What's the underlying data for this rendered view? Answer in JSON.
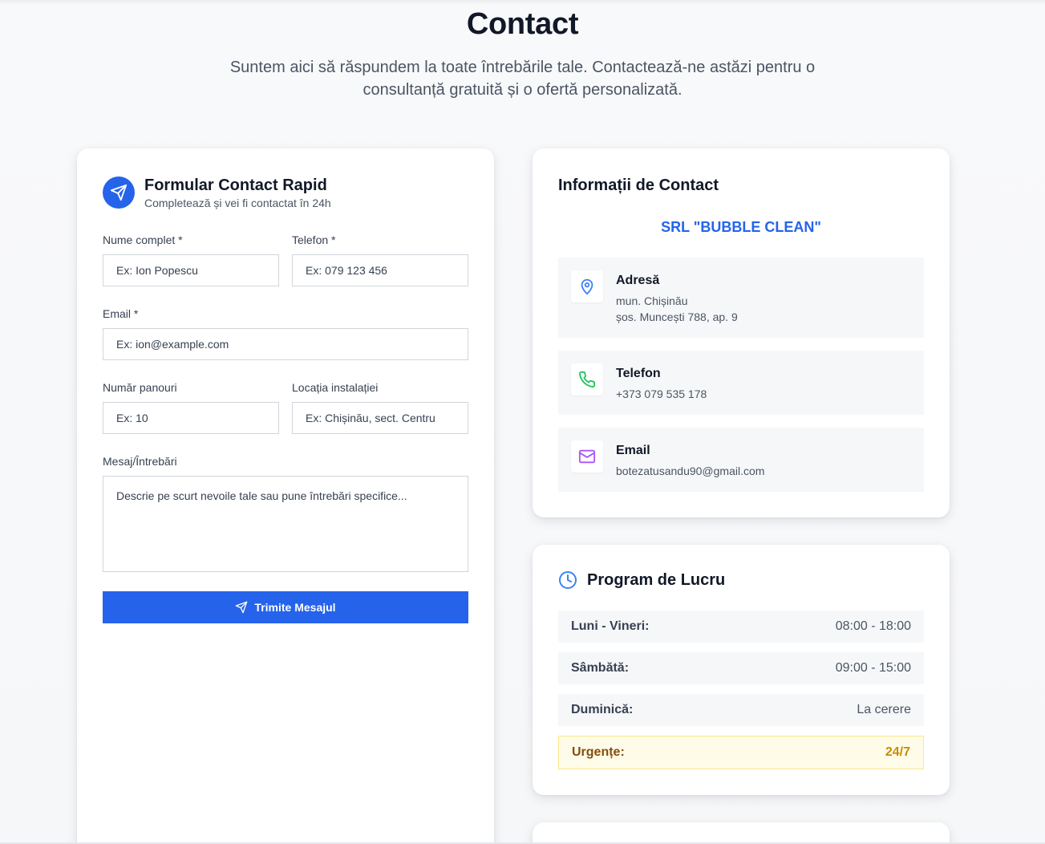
{
  "hero": {
    "title": "Contact",
    "subtitle": "Suntem aici să răspundem la toate întrebările tale. Contactează-ne astăzi pentru o consultanță gratuită și o ofertă personalizată."
  },
  "form": {
    "title": "Formular Contact Rapid",
    "subtitle": "Completează și vei fi contactat în 24h",
    "name_label": "Nume complet *",
    "name_placeholder": "Ex: Ion Popescu",
    "phone_label": "Telefon *",
    "phone_placeholder": "Ex: 079 123 456",
    "email_label": "Email *",
    "email_placeholder": "Ex: ion@example.com",
    "panels_label": "Număr panouri",
    "panels_placeholder": "Ex: 10",
    "location_label": "Locația instalației",
    "location_placeholder": "Ex: Chișinău, sect. Centru",
    "message_label": "Mesaj/Întrebări",
    "message_placeholder": "Descrie pe scurt nevoile tale sau pune întrebări specifice...",
    "submit_label": "Trimite Mesajul"
  },
  "contact_info": {
    "title": "Informații de Contact",
    "company": "SRL \"BUBBLE CLEAN\"",
    "address": {
      "title": "Adresă",
      "line1": "mun. Chișinău",
      "line2": "șos. Muncești 788, ap. 9",
      "icon": "map-pin-icon",
      "color": "#3b82f6"
    },
    "phone": {
      "title": "Telefon",
      "value": "+373 079 535 178",
      "icon": "phone-icon",
      "color": "#22c55e"
    },
    "email": {
      "title": "Email",
      "value": "botezatusandu90@gmail.com",
      "icon": "mail-icon",
      "color": "#a855f7"
    }
  },
  "schedule": {
    "title": "Program de Lucru",
    "rows": [
      {
        "day": "Luni - Vineri:",
        "hours": "08:00 - 18:00"
      },
      {
        "day": "Sâmbătă:",
        "hours": "09:00 - 15:00"
      },
      {
        "day": "Duminică:",
        "hours": "La cerere"
      }
    ],
    "urgent": {
      "day": "Urgențe:",
      "hours": "24/7"
    }
  },
  "colors": {
    "accent": "#2563eb",
    "urgent_bg": "#fefce8",
    "urgent_text": "#ca8a04"
  }
}
